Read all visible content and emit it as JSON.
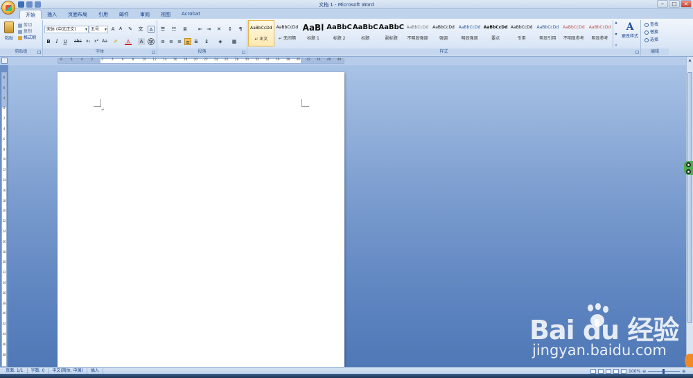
{
  "window": {
    "title": "文档 1 - Microsoft Word"
  },
  "ribbon_tabs": [
    {
      "label": "开始",
      "active": true
    },
    {
      "label": "插入",
      "active": false
    },
    {
      "label": "页面布局",
      "active": false
    },
    {
      "label": "引用",
      "active": false
    },
    {
      "label": "邮件",
      "active": false
    },
    {
      "label": "审阅",
      "active": false
    },
    {
      "label": "视图",
      "active": false
    },
    {
      "label": "Acrobat",
      "active": false
    }
  ],
  "clipboard": {
    "paste_label": "粘贴",
    "cut_label": "剪切",
    "copy_label": "复制",
    "format_painter_label": "格式刷",
    "group_label": "剪贴板"
  },
  "font": {
    "font_name": "宋体 (中文正文)",
    "font_size": "五号",
    "group_label": "字体"
  },
  "paragraph": {
    "group_label": "段落"
  },
  "styles": {
    "group_label": "样式",
    "items": [
      {
        "preview": "AaBbCcDd",
        "name": "↵ 正文",
        "selected": true,
        "weight": "normal",
        "size": "6px",
        "color": "#111111"
      },
      {
        "preview": "AaBbCcDd",
        "name": "↵ 无间隔",
        "selected": false,
        "weight": "normal",
        "size": "6px",
        "color": "#111111"
      },
      {
        "preview": "AaBl",
        "name": "标题 1",
        "selected": false,
        "weight": "bold",
        "size": "12px",
        "color": "#111111"
      },
      {
        "preview": "AaBbC",
        "name": "标题 2",
        "selected": false,
        "weight": "bold",
        "size": "10px",
        "color": "#111111"
      },
      {
        "preview": "AaBbC",
        "name": "标题",
        "selected": false,
        "weight": "bold",
        "size": "10px",
        "color": "#111111"
      },
      {
        "preview": "AaBbC",
        "name": "副标题",
        "selected": false,
        "weight": "bold",
        "size": "10px",
        "color": "#111111"
      },
      {
        "preview": "AaBbCcDd",
        "name": "不明显强调",
        "selected": false,
        "weight": "normal",
        "size": "6px",
        "color": "#777777"
      },
      {
        "preview": "AaBbCcDd",
        "name": "强调",
        "selected": false,
        "weight": "normal",
        "size": "6px",
        "color": "#111111"
      },
      {
        "preview": "AaBbCcDd",
        "name": "明显强调",
        "selected": false,
        "weight": "normal",
        "size": "6px",
        "color": "#2f5597"
      },
      {
        "preview": "AaBbCcDd",
        "name": "要点",
        "selected": false,
        "weight": "bold",
        "size": "6px",
        "color": "#111111"
      },
      {
        "preview": "AaBbCcDd",
        "name": "引用",
        "selected": false,
        "weight": "normal",
        "size": "6px",
        "color": "#111111"
      },
      {
        "preview": "AaBbCcDd",
        "name": "明显引用",
        "selected": false,
        "weight": "normal",
        "size": "6px",
        "color": "#2f5597"
      },
      {
        "preview": "AaBbCcDd",
        "name": "不明显参考",
        "selected": false,
        "weight": "normal",
        "size": "6px",
        "color": "#c0504d"
      },
      {
        "preview": "AaBbCcDd",
        "name": "明显参考",
        "selected": false,
        "weight": "normal",
        "size": "6px",
        "color": "#c0504d"
      }
    ],
    "change_styles_label": "更改样式"
  },
  "editing": {
    "group_label": "编辑",
    "find_label": "查找",
    "replace_label": "替换",
    "select_label": "选择"
  },
  "ruler_numbers": [
    "8",
    "6",
    "4",
    "2",
    "2",
    "4",
    "6",
    "8",
    "10",
    "12",
    "14",
    "16",
    "18",
    "20",
    "22",
    "24",
    "26",
    "28",
    "30",
    "32",
    "34",
    "36",
    "38",
    "40",
    "42",
    "44",
    "46",
    "48"
  ],
  "status": {
    "page": "页面: 1/1",
    "words": "字数: 0",
    "language": "中文(简体, 中国)",
    "mode": "插入",
    "zoom": "100%"
  },
  "watermark": {
    "logo_text": "Bai  du 经验",
    "url": "jingyan.baidu.com"
  }
}
